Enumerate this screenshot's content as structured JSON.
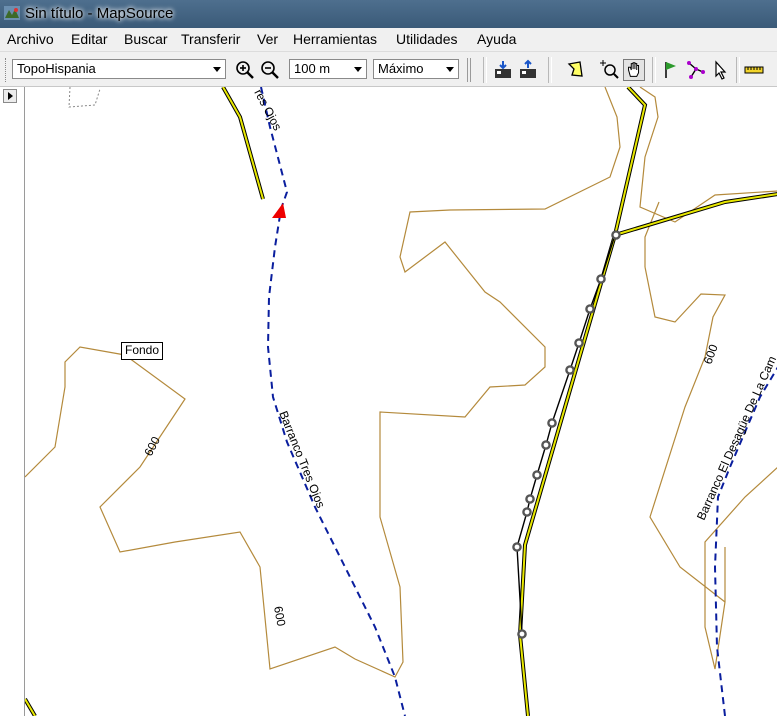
{
  "window": {
    "title": "Sin título - MapSource"
  },
  "menu": [
    "Archivo",
    "Editar",
    "Buscar",
    "Transferir",
    "Ver",
    "Herramientas",
    "Utilidades",
    "Ayuda"
  ],
  "toolbar": {
    "map_product": "TopoHispania",
    "zoom_scale": "100 m",
    "detail_level": "Máximo"
  },
  "map": {
    "waypoint_label": "Fondo",
    "stream_name_1": "Barranco Tres Ojos",
    "stream_name_1_partial": "res Ojos",
    "stream_name_2": "Barranco El Desagüe De La Cam",
    "contour_label": "600",
    "colors": {
      "contour": "#b48a3c",
      "road": "#e8e800",
      "stream": "#0a1e9e"
    }
  }
}
